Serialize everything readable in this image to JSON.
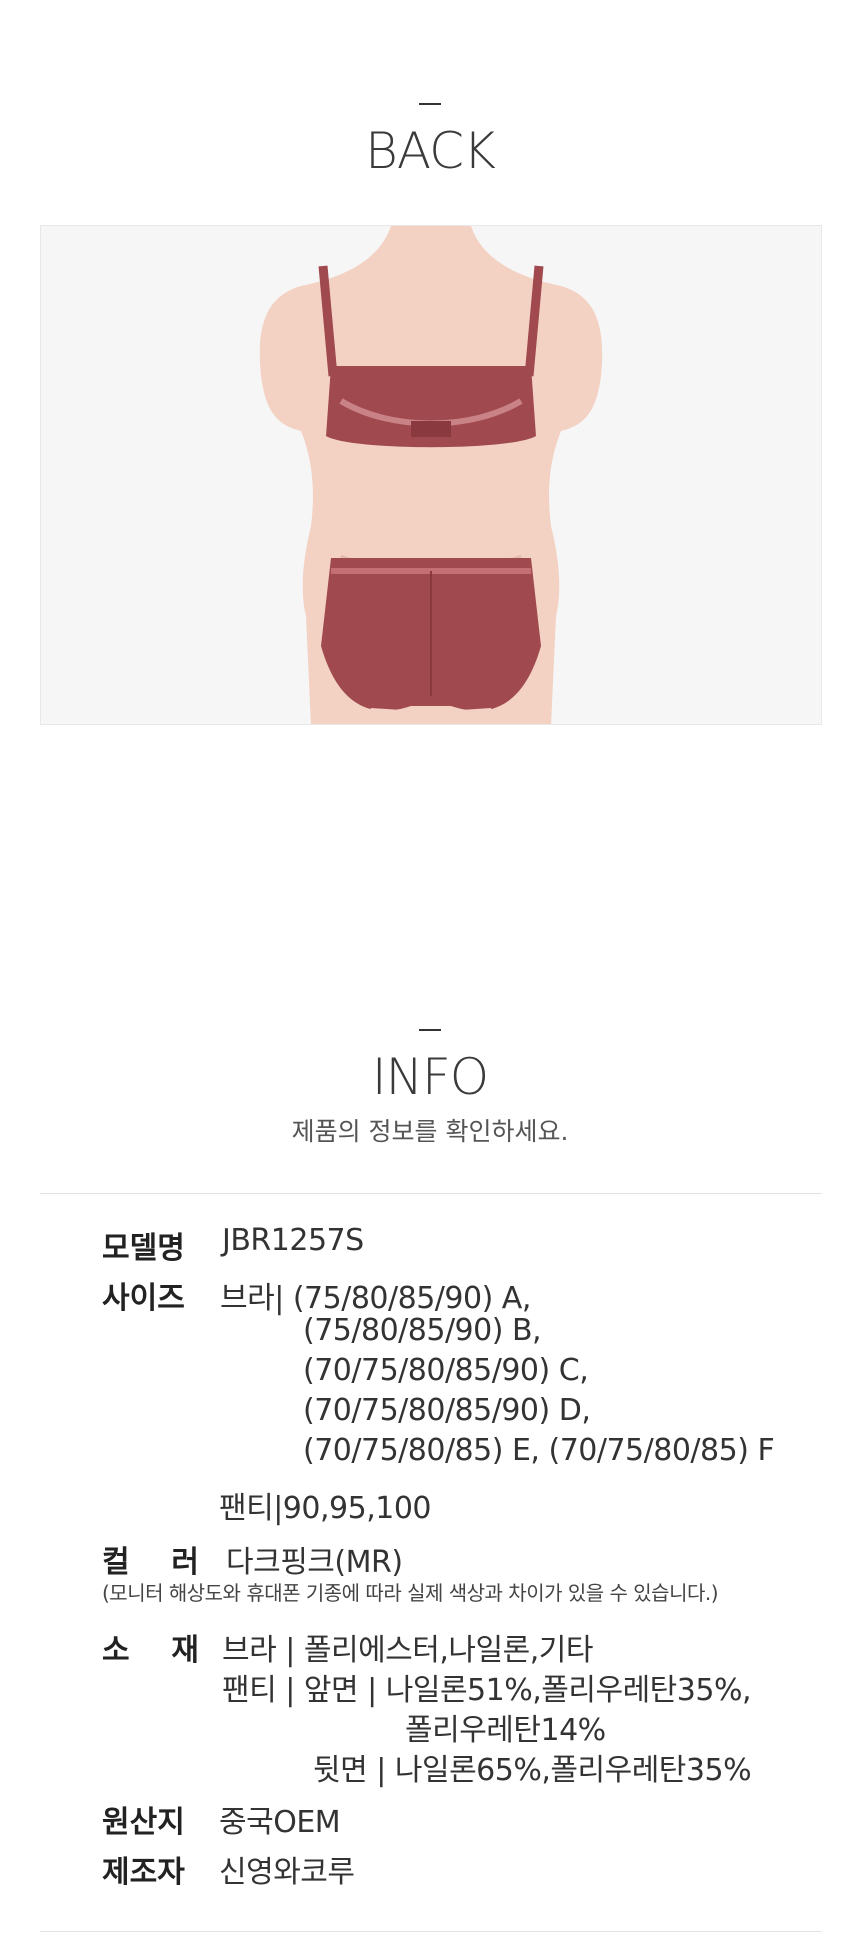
{
  "back": {
    "title": "BACK"
  },
  "photo": {
    "icon": "mannequin-back-icon",
    "colors": {
      "garment": "#a04a4f",
      "skin": "#f3d2c4",
      "background": "#f6f6f6"
    }
  },
  "info": {
    "title": "INFO",
    "subtitle": "제품의 정보를 확인하세요.",
    "rows": {
      "model": {
        "label": "모델명",
        "value": "JBR1257S"
      },
      "size": {
        "label": "사이즈",
        "lines": [
          "브라| (75/80/85/90) A,",
          "(75/80/85/90) B,",
          "(70/75/80/85/90) C,",
          "(70/75/80/85/90) D,",
          "(70/75/80/85) E, (70/75/80/85) F",
          "팬티|90,95,100"
        ]
      },
      "color": {
        "label": "컬    러",
        "value": "다크핑크(MR)",
        "note": "(모니터 해상도와 휴대폰 기종에 따라 실제 색상과 차이가 있을 수 있습니다.)"
      },
      "material": {
        "label": "소    재",
        "lines": [
          "브라 | 폴리에스터,나일론,기타",
          "팬티 | 앞면 | 나일론51%,폴리우레탄35%,",
          "폴리우레탄14%",
          "뒷면 | 나일론65%,폴리우레탄35%"
        ]
      },
      "origin": {
        "label": "원산지",
        "value": "중국OEM"
      },
      "maker": {
        "label": "제조자",
        "value": "신영와코루"
      }
    }
  }
}
